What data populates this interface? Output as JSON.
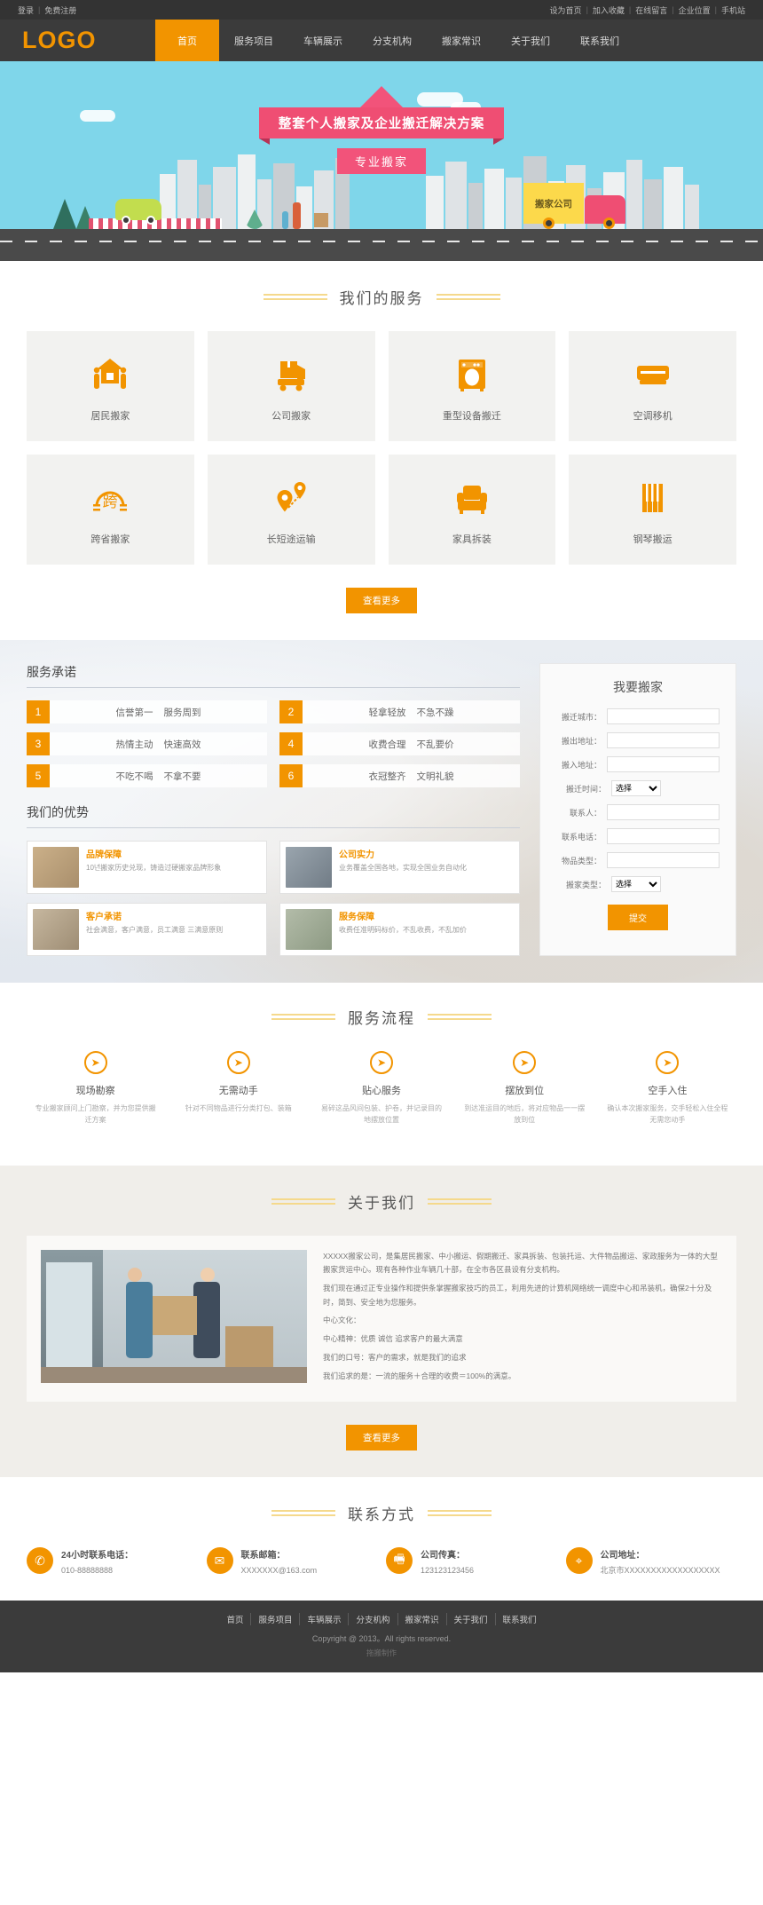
{
  "topbar": {
    "left": [
      {
        "label": "登录"
      },
      {
        "label": "免费注册"
      }
    ],
    "right": [
      {
        "label": "设为首页"
      },
      {
        "label": "加入收藏"
      },
      {
        "label": "在线留言"
      },
      {
        "label": "企业位置"
      },
      {
        "label": "手机站"
      }
    ]
  },
  "header": {
    "logo": "LOGO",
    "nav": [
      {
        "label": "首页",
        "active": true
      },
      {
        "label": "服务项目",
        "active": false
      },
      {
        "label": "车辆展示",
        "active": false
      },
      {
        "label": "分支机构",
        "active": false
      },
      {
        "label": "搬家常识",
        "active": false
      },
      {
        "label": "关于我们",
        "active": false
      },
      {
        "label": "联系我们",
        "active": false
      }
    ]
  },
  "banner": {
    "ribbon_main": "整套个人搬家及企业搬迁解决方案",
    "ribbon_sub": "专业搬家",
    "truck_text": "搬家公司"
  },
  "services": {
    "title": "我们的服务",
    "more": "查看更多",
    "items": [
      {
        "label": "居民搬家",
        "icon": "house-with-movers-icon"
      },
      {
        "label": "公司搬家",
        "icon": "box-cart-icon"
      },
      {
        "label": "重型设备搬迁",
        "icon": "washing-machine-icon"
      },
      {
        "label": "空调移机",
        "icon": "air-conditioner-icon"
      },
      {
        "label": "跨省搬家",
        "icon": "cross-province-icon"
      },
      {
        "label": "长短途运输",
        "icon": "map-pins-route-icon"
      },
      {
        "label": "家具拆装",
        "icon": "sofa-icon"
      },
      {
        "label": "钢琴搬运",
        "icon": "piano-keys-icon"
      }
    ]
  },
  "promise": {
    "title": "服务承诺",
    "items": [
      {
        "num": "1",
        "a": "信誉第一",
        "b": "服务周到"
      },
      {
        "num": "2",
        "a": "轻拿轻放",
        "b": "不急不躁"
      },
      {
        "num": "3",
        "a": "热情主动",
        "b": "快速高效"
      },
      {
        "num": "4",
        "a": "收费合理",
        "b": "不乱要价"
      },
      {
        "num": "5",
        "a": "不吃不喝",
        "b": "不拿不要"
      },
      {
        "num": "6",
        "a": "衣冠整齐",
        "b": "文明礼貌"
      }
    ]
  },
  "advantages": {
    "title": "我们的优势",
    "items": [
      {
        "heading": "品牌保障",
        "text": "10년搬家历史兑现，铸造过硬搬家品牌形象",
        "photo": "#c9ab86"
      },
      {
        "heading": "公司实力",
        "text": "业务覆盖全国各地，实现全国业务自动化",
        "photo": "#8e99a4"
      },
      {
        "heading": "客户承诺",
        "text": "社会满意，客户满意，员工满意 三满意原则",
        "photo": "#b7a894"
      },
      {
        "heading": "服务保障",
        "text": "收费任准明码标价，不乱收费，不乱加价",
        "photo": "#a8b3a0"
      }
    ]
  },
  "form": {
    "title": "我要搬家",
    "fields": [
      {
        "label": "搬迁城市：",
        "type": "text",
        "value": ""
      },
      {
        "label": "搬出地址：",
        "type": "text",
        "value": ""
      },
      {
        "label": "搬入地址：",
        "type": "text",
        "value": ""
      },
      {
        "label": "搬迁时间：",
        "type": "select",
        "value": "选择"
      },
      {
        "label": "联系人：",
        "type": "text",
        "value": ""
      },
      {
        "label": "联系电话：",
        "type": "text",
        "value": ""
      },
      {
        "label": "物品类型：",
        "type": "text",
        "value": ""
      },
      {
        "label": "搬家类型：",
        "type": "select",
        "value": "选择"
      }
    ],
    "submit": "提交"
  },
  "flow": {
    "title": "服务流程",
    "steps": [
      {
        "heading": "现场勘察",
        "text": "专业搬家顾问上门勘察，并为您提供搬迁方案"
      },
      {
        "heading": "无需动手",
        "text": "针对不同物品进行分类打包、装箱"
      },
      {
        "heading": "贴心服务",
        "text": "易碎这品风间包装、护卷，并记录目的地摆放位置"
      },
      {
        "heading": "摆放到位",
        "text": "到达准运目的地后，将对应物品一一摆放到位"
      },
      {
        "heading": "空手入住",
        "text": "确认本次搬家服务，交手轻松入住全程无需您动手"
      }
    ]
  },
  "about": {
    "title": "关于我们",
    "more": "查看更多",
    "paragraphs": [
      "XXXXX搬家公司，是集居民搬家、中小搬运、假期搬迁、家具拆装、包装托运、大件物品搬运、家政服务为一体的大型搬家货运中心。现有各种作业车辆几十部，在全市各区县设有分支机构。",
      "我们现在通过正专业操作和提供条掌握搬家技巧的员工，利用先进的计算机网络统一调度中心和吊装机，确保2十分及时，简到、安全地为您服务。",
      "中心文化：",
      "中心精神：优质 诚信 追求客户的最大满意",
      "我们的口号：客户的需求，就是我们的追求",
      "我们追求的是：一流的服务＋合理的收费＝100%的满意。"
    ]
  },
  "contact": {
    "title": "联系方式",
    "items": [
      {
        "icon": "phone-icon",
        "heading": "24小时联系电话：",
        "text": "010-88888888"
      },
      {
        "icon": "envelope-icon",
        "heading": "联系邮箱：",
        "text": "XXXXXXX@163.com"
      },
      {
        "icon": "fax-icon",
        "heading": "公司传真：",
        "text": "123123123456"
      },
      {
        "icon": "location-pin-icon",
        "heading": "公司地址：",
        "text": "北京市XXXXXXXXXXXXXXXXXX"
      }
    ]
  },
  "footer": {
    "nav": [
      {
        "label": "首页"
      },
      {
        "label": "服务项目"
      },
      {
        "label": "车辆展示"
      },
      {
        "label": "分支机构"
      },
      {
        "label": "搬家常识"
      },
      {
        "label": "关于我们"
      },
      {
        "label": "联系我们"
      }
    ],
    "copyright": "Copyright @ 2013。All rights reserved.",
    "made": "拖搬制作"
  },
  "colors": {
    "accent": "#f29400",
    "dark": "#3b3b3b",
    "pink": "#ef4e73",
    "sky": "#7fd6ea"
  }
}
